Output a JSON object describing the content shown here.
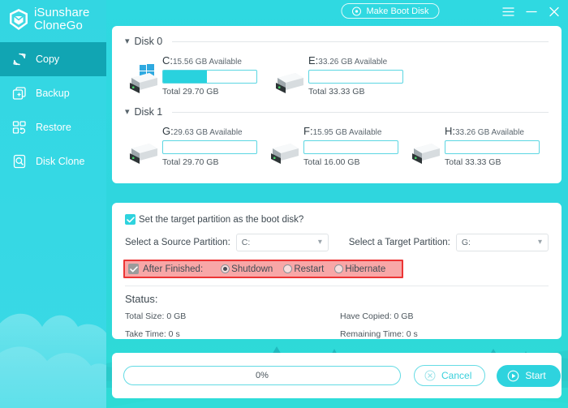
{
  "app": {
    "brand_line1": "iSunshare",
    "brand_line2": "CloneGo",
    "accent": "#2ed3de",
    "sidebar_active_bg": "#11a5b3",
    "highlight_border": "#ec3535",
    "highlight_fill": "#f8a7a7"
  },
  "sidebar": {
    "items": [
      {
        "label": "Copy",
        "icon": "refresh-copy-icon",
        "active": true
      },
      {
        "label": "Backup",
        "icon": "backup-plus-icon",
        "active": false
      },
      {
        "label": "Restore",
        "icon": "restore-blocks-icon",
        "active": false
      },
      {
        "label": "Disk Clone",
        "icon": "disk-clone-icon",
        "active": false
      }
    ]
  },
  "topbar": {
    "make_boot_disk": "Make Boot Disk",
    "menu_icon": "hamburger-menu-icon",
    "minimize_icon": "minimize-icon",
    "close_icon": "close-icon"
  },
  "disks": [
    {
      "name": "Disk 0",
      "partitions": [
        {
          "letter": "C:",
          "available": "15.56 GB Available",
          "total": "Total 29.70 GB",
          "used_percent": 47,
          "has_windows_badge": true
        },
        {
          "letter": "E:",
          "available": "33.26 GB Available",
          "total": "Total 33.33 GB",
          "used_percent": 0,
          "has_windows_badge": false
        }
      ]
    },
    {
      "name": "Disk 1",
      "partitions": [
        {
          "letter": "G:",
          "available": "29.63 GB Available",
          "total": "Total 29.70 GB",
          "used_percent": 0,
          "has_windows_badge": false
        },
        {
          "letter": "F:",
          "available": "15.95 GB Available",
          "total": "Total 16.00 GB",
          "used_percent": 0,
          "has_windows_badge": false
        },
        {
          "letter": "H:",
          "available": "33.26 GB Available",
          "total": "Total 33.33 GB",
          "used_percent": 0,
          "has_windows_badge": false
        }
      ]
    }
  ],
  "settings": {
    "boot_disk_label": "Set the target partition as the boot disk?",
    "boot_disk_checked": true,
    "source_label": "Select a Source Partition:",
    "source_value": "C:",
    "target_label": "Select a Target Partition:",
    "target_value": "G:",
    "after_finished_label": "After Finished:",
    "after_finished_checked": true,
    "after_options": [
      {
        "label": "Shutdown",
        "selected": true
      },
      {
        "label": "Restart",
        "selected": false
      },
      {
        "label": "Hibernate",
        "selected": false
      }
    ]
  },
  "status": {
    "title": "Status:",
    "total_size": "Total Size: 0 GB",
    "have_copied": "Have Copied: 0 GB",
    "take_time": "Take Time: 0 s",
    "remaining_time": "Remaining Time: 0 s"
  },
  "actions": {
    "progress_text": "0%",
    "progress_percent": 0,
    "cancel_label": "Cancel",
    "cancel_icon": "cancel-circle-x-icon",
    "start_label": "Start",
    "start_icon": "play-circle-icon"
  }
}
